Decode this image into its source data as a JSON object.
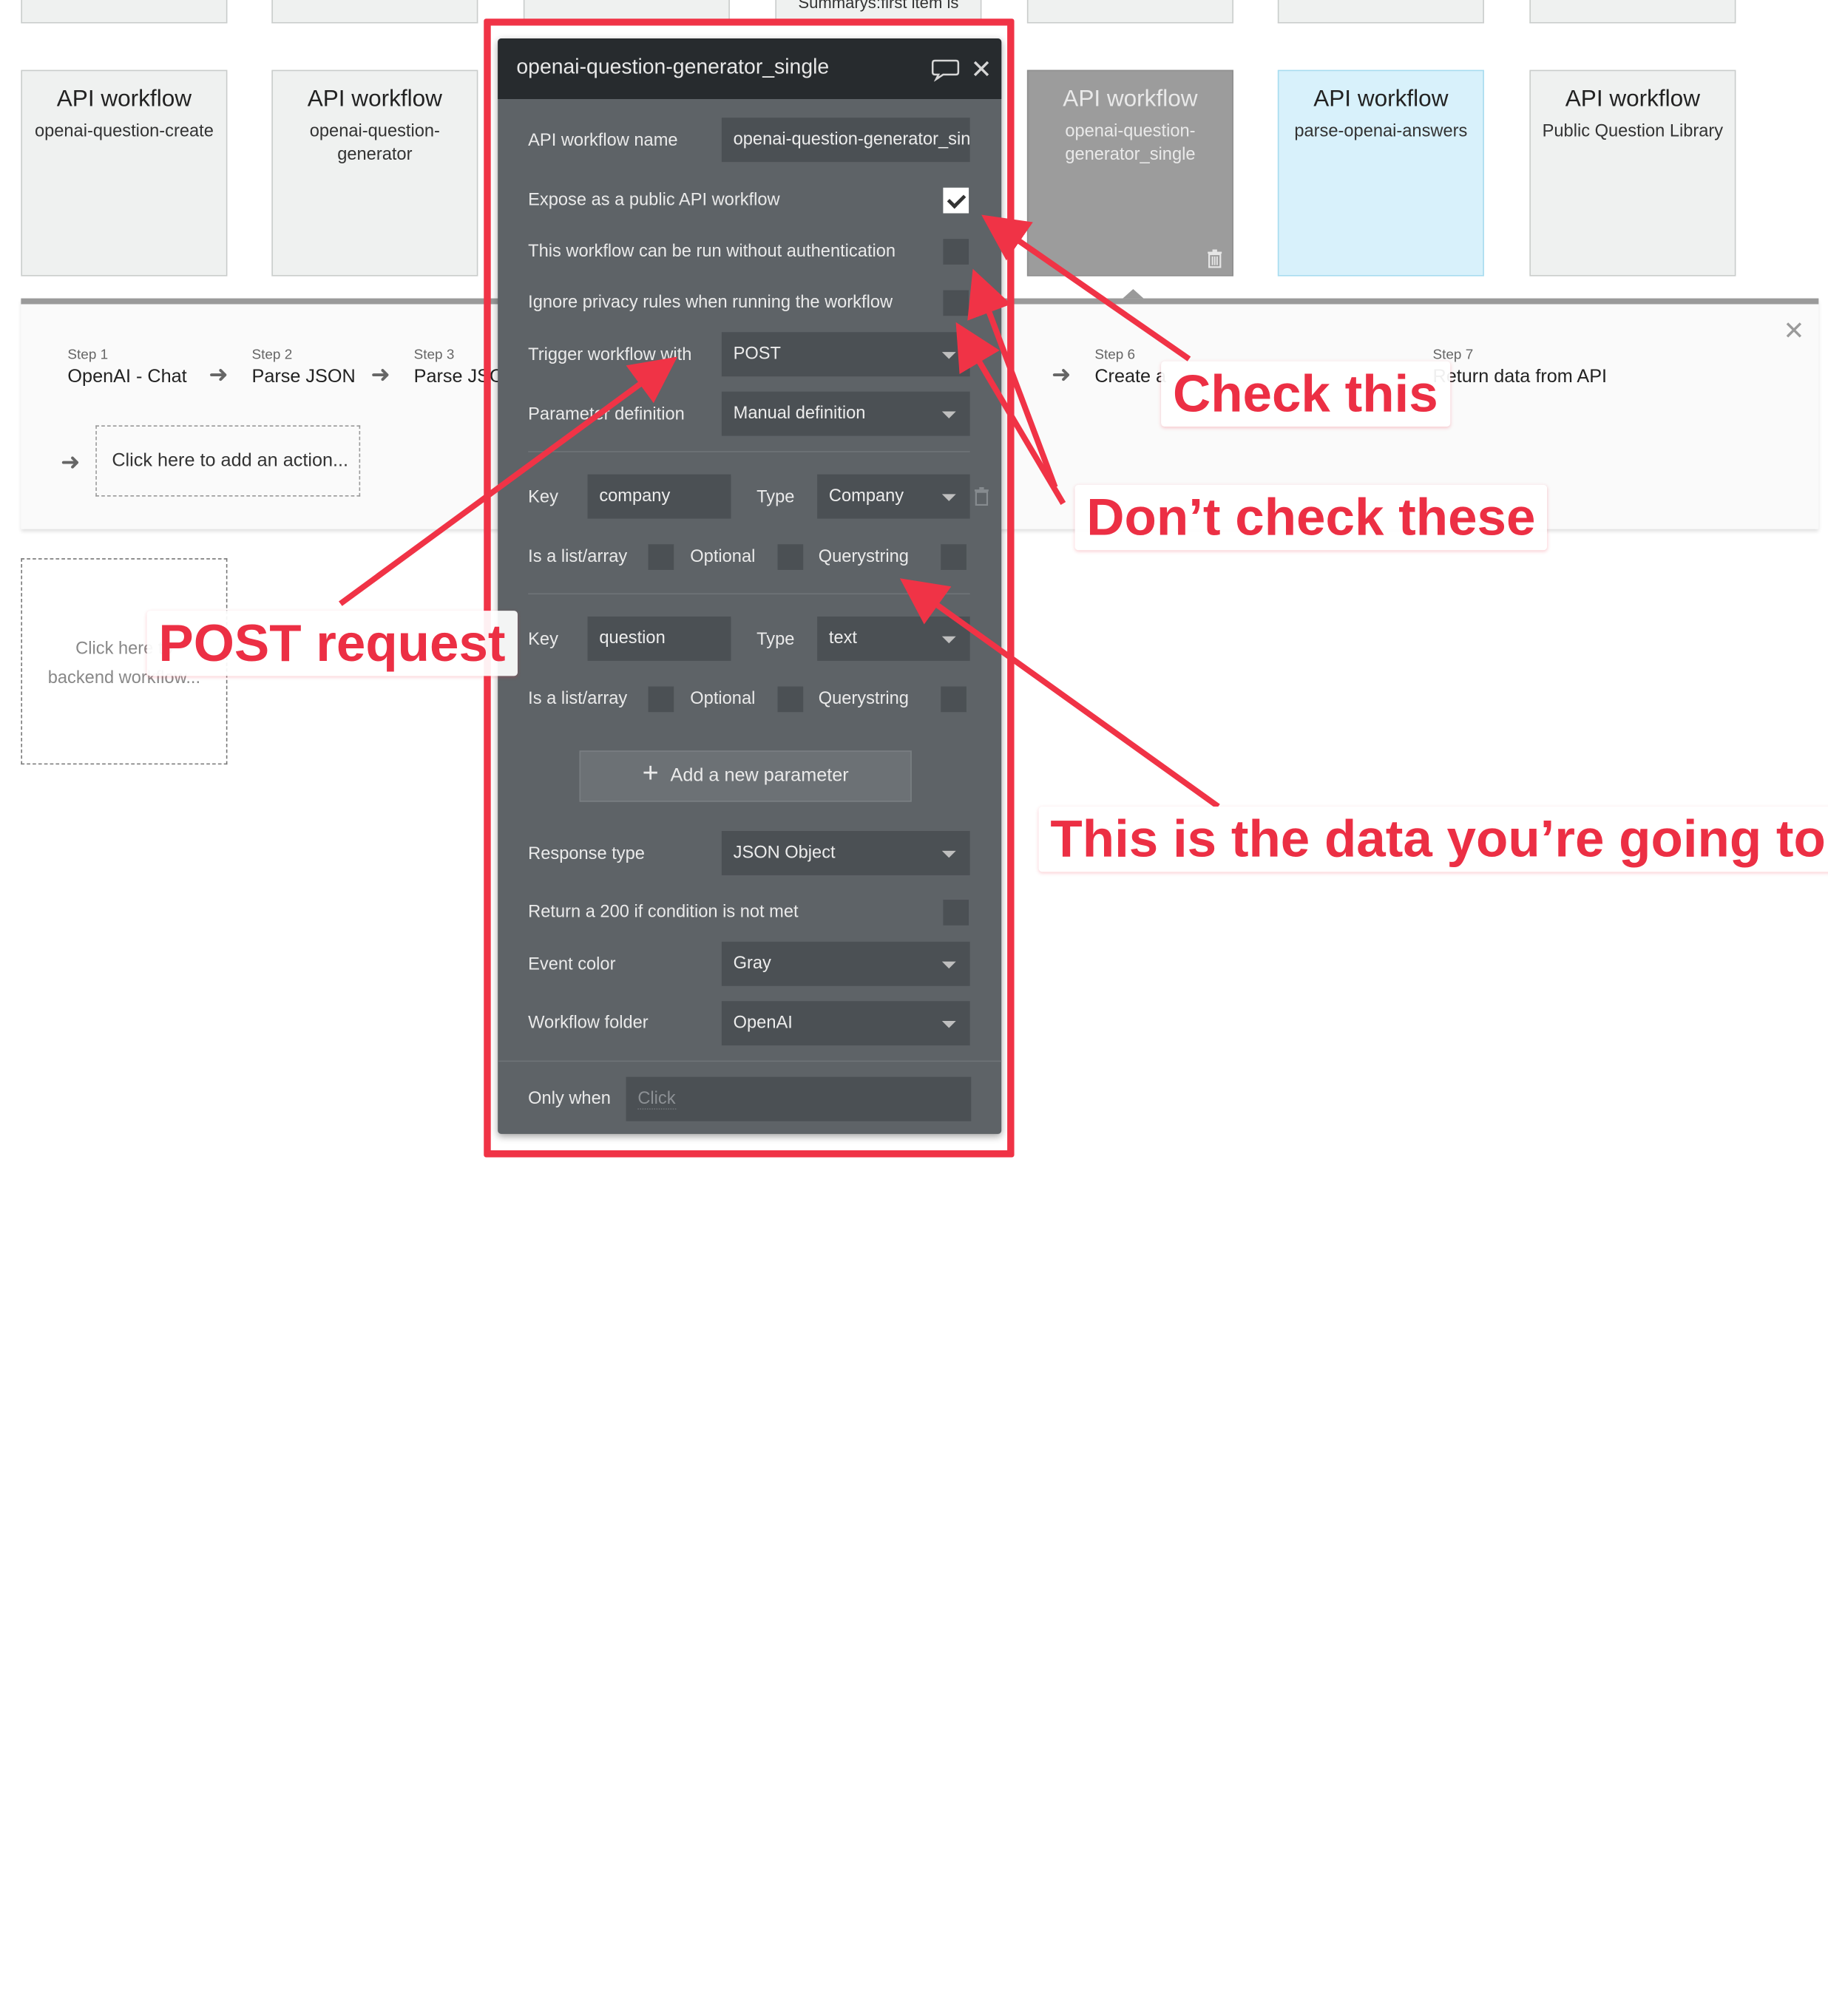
{
  "top_stub": {
    "text": "Summarys:first item is"
  },
  "cards": [
    {
      "title": "API workflow",
      "subtitle": "openai-question-create"
    },
    {
      "title": "API workflow",
      "subtitle": "openai-question-generator"
    },
    {
      "title": "API workflow",
      "subtitle": "openai-question-generator_single"
    },
    {
      "title": "API workflow",
      "subtitle": "parse-openai-answers"
    },
    {
      "title": "API workflow",
      "subtitle": "Public Question Library"
    }
  ],
  "steps": [
    {
      "label": "Step 1",
      "name": "OpenAI - Chat"
    },
    {
      "label": "Step 2",
      "name": "Parse JSON"
    },
    {
      "label": "Step 3",
      "name": "Parse JSON"
    },
    {
      "label": "Step 6",
      "name": "Create a"
    },
    {
      "label": "Step 7",
      "name": "Return data from API"
    }
  ],
  "add_action": "Click here to add an action...",
  "add_backend": {
    "line1": "Click here to",
    "line2": "backend workflow..."
  },
  "panel": {
    "title": "openai-question-generator_single",
    "name_label": "API workflow name",
    "name_value": "openai-question-generator_single",
    "expose_label": "Expose as a public API workflow",
    "expose_checked": true,
    "noauth_label": "This workflow can be run without authentication",
    "noauth_checked": false,
    "privacy_label": "Ignore privacy rules when running the workflow",
    "privacy_checked": false,
    "trigger_label": "Trigger workflow with",
    "trigger_value": "POST",
    "paramdef_label": "Parameter definition",
    "paramdef_value": "Manual definition",
    "params": [
      {
        "key_label": "Key",
        "key": "company",
        "type_label": "Type",
        "type": "Company",
        "list_label": "Is a list/array",
        "optional_label": "Optional",
        "query_label": "Querystring"
      },
      {
        "key_label": "Key",
        "key": "question",
        "type_label": "Type",
        "type": "text",
        "list_label": "Is a list/array",
        "optional_label": "Optional",
        "query_label": "Querystring"
      }
    ],
    "add_param": "Add a new parameter",
    "response_label": "Response type",
    "response_value": "JSON Object",
    "return200_label": "Return a 200 if condition is not met",
    "eventcolor_label": "Event color",
    "eventcolor_value": "Gray",
    "folder_label": "Workflow folder",
    "folder_value": "OpenAI",
    "onlywhen_label": "Only when",
    "onlywhen_placeholder": "Click"
  },
  "annotations": {
    "check_this": "Check this",
    "dont_check": "Don’t check these",
    "post_request": "POST request",
    "data_note": "This is the data you’re going to i",
    "color": "#f03346"
  }
}
